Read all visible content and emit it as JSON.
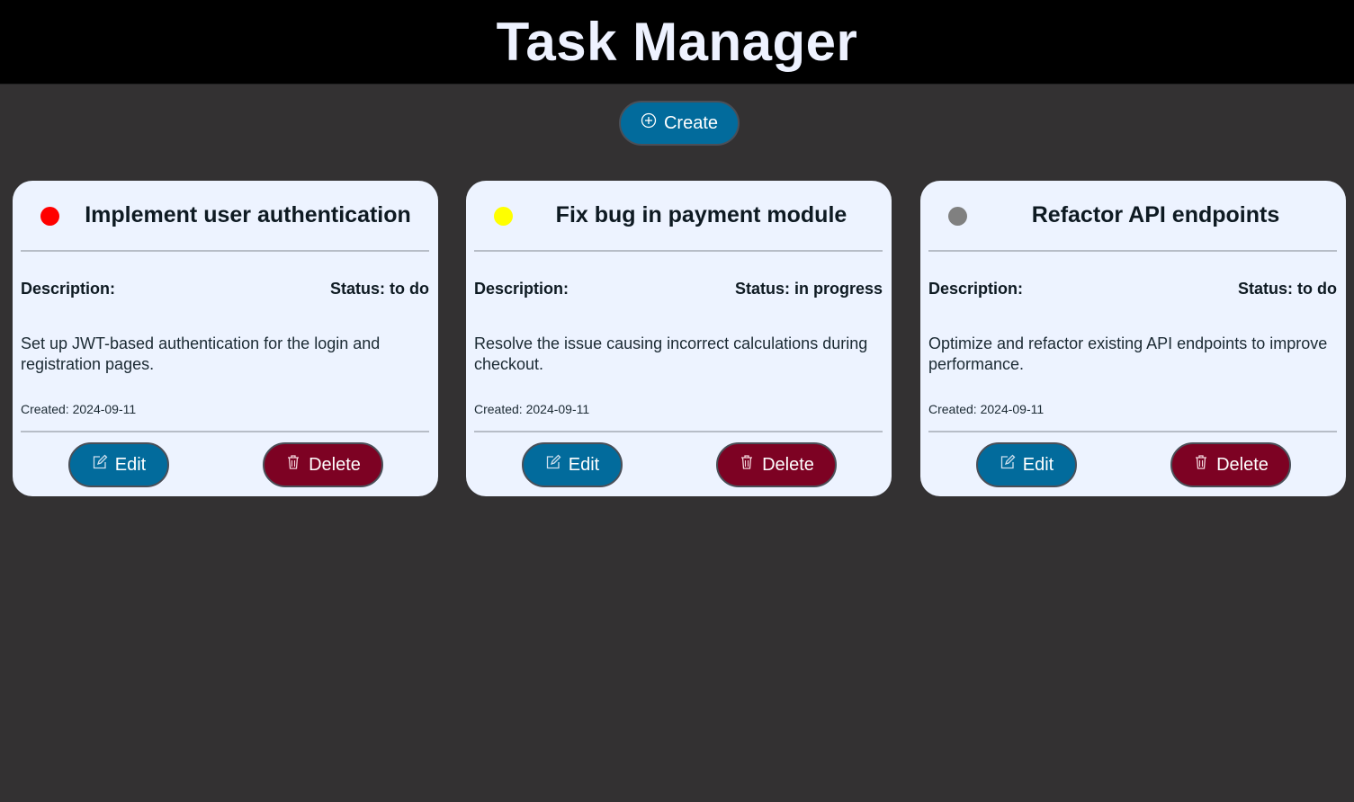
{
  "header": {
    "title": "Task Manager"
  },
  "toolbar": {
    "create_label": "Create",
    "create_icon": "plus-circle-icon"
  },
  "colors": {
    "background": "#333132",
    "header_bg": "#000000",
    "card_bg": "#edf3ff",
    "primary_button": "#026b9c",
    "danger_button": "#7d0223"
  },
  "tasks": [
    {
      "title": "Implement user authentication",
      "priority_color": "#ff0000",
      "description_label": "Description:",
      "status_text": "Status: to do",
      "description": "Set up JWT-based authentication for the login and registration pages.",
      "created": "Created: 2024-09-11",
      "edit_label": "Edit",
      "delete_label": "Delete"
    },
    {
      "title": "Fix bug in payment module",
      "priority_color": "#ffff00",
      "description_label": "Description:",
      "status_text": "Status: in progress",
      "description": "Resolve the issue causing incorrect calculations during checkout.",
      "created": "Created: 2024-09-11",
      "edit_label": "Edit",
      "delete_label": "Delete"
    },
    {
      "title": "Refactor API endpoints",
      "priority_color": "#808080",
      "description_label": "Description:",
      "status_text": "Status: to do",
      "description": "Optimize and refactor existing API endpoints to improve performance.",
      "created": "Created: 2024-09-11",
      "edit_label": "Edit",
      "delete_label": "Delete"
    }
  ]
}
